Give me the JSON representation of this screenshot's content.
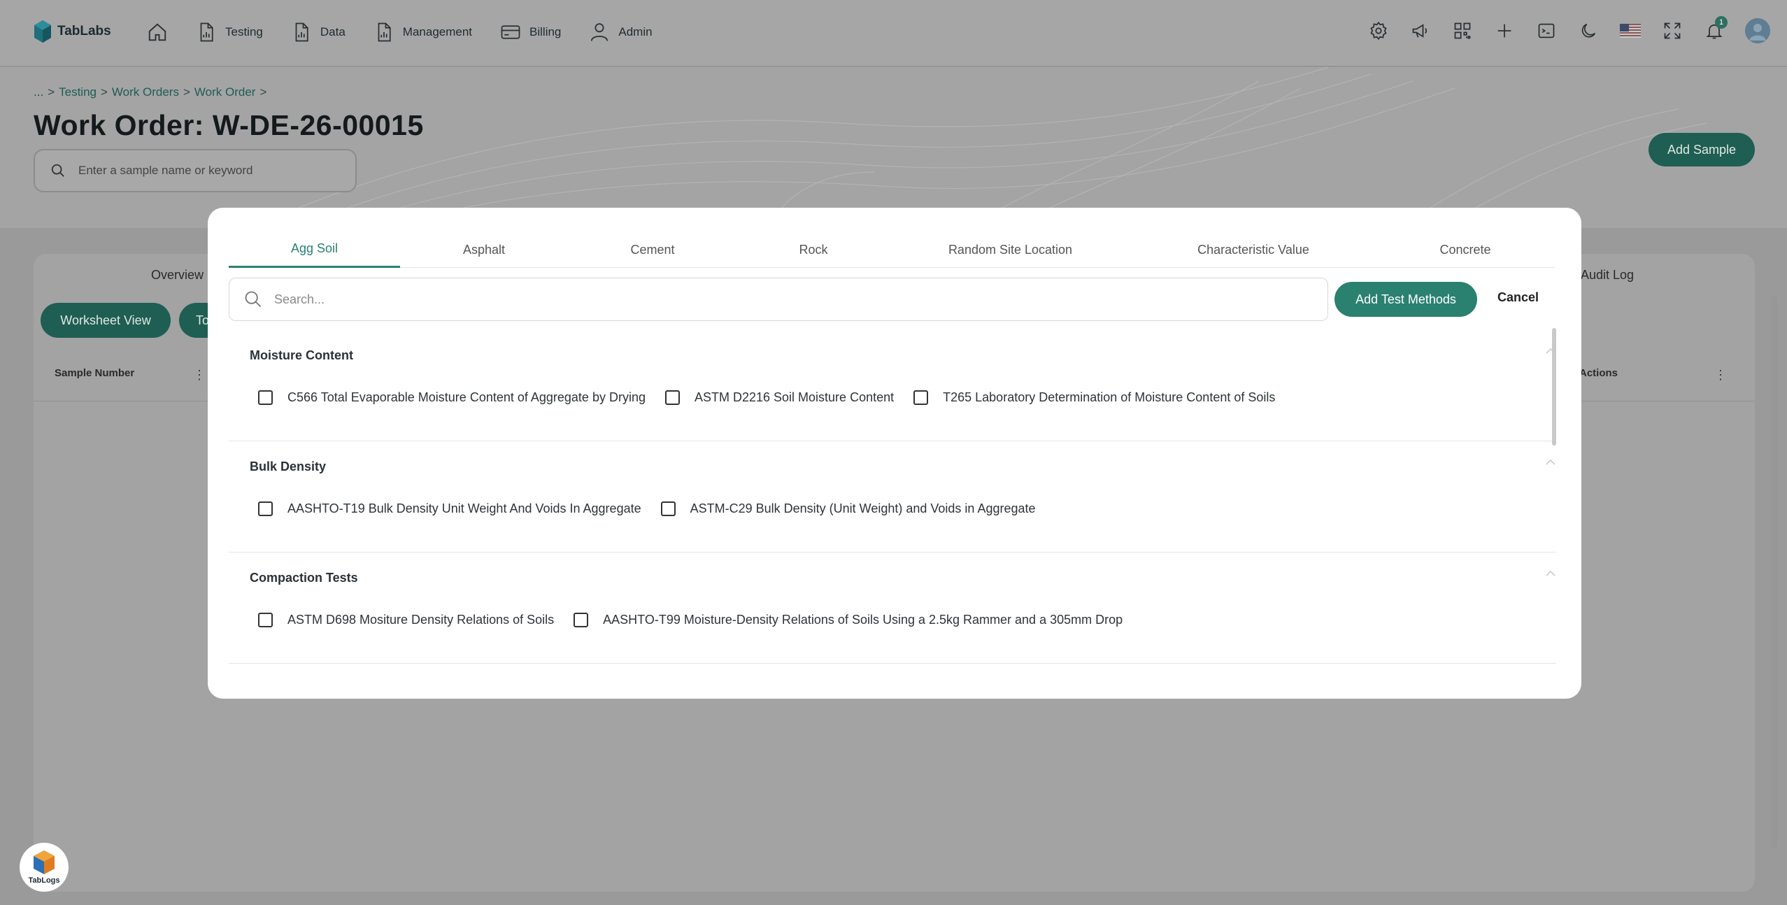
{
  "brand": {
    "name": "TabLabs"
  },
  "nav": [
    {
      "label": "",
      "icon": "home-icon"
    },
    {
      "label": "Testing",
      "icon": "document-chart-icon"
    },
    {
      "label": "Data",
      "icon": "document-chart-icon"
    },
    {
      "label": "Management",
      "icon": "document-chart-icon"
    },
    {
      "label": "Billing",
      "icon": "credit-card-icon"
    },
    {
      "label": "Admin",
      "icon": "user-icon"
    }
  ],
  "topbar": {
    "icons": [
      "gear-icon",
      "megaphone-icon",
      "qr-code-icon",
      "plus-icon",
      "terminal-icon",
      "moon-icon",
      "us-flag-icon",
      "expand-icon",
      "bell-icon",
      "avatar"
    ],
    "notification_count": "1"
  },
  "breadcrumb": {
    "ellipsis": "...",
    "items": [
      "Testing",
      "Work Orders",
      "Work Order"
    ],
    "separator": ">"
  },
  "page": {
    "title": "Work Order: W-DE-26-00015",
    "search_placeholder": "Enter a sample name or keyword",
    "add_sample_label": "Add Sample"
  },
  "card": {
    "tab_left": "Overview",
    "tab_right": "Audit Log",
    "worksheet_view_label": "Worksheet View",
    "table_view_label_partial": "To",
    "columns": {
      "sample_number": "Sample Number",
      "actions": "Actions"
    }
  },
  "modal": {
    "tabs": [
      {
        "label": "Agg Soil",
        "active": true
      },
      {
        "label": "Asphalt",
        "active": false
      },
      {
        "label": "Cement",
        "active": false
      },
      {
        "label": "Rock",
        "active": false
      },
      {
        "label": "Random Site Location",
        "active": false
      },
      {
        "label": "Characteristic Value",
        "active": false
      },
      {
        "label": "Concrete",
        "active": false
      }
    ],
    "search_placeholder": "Search...",
    "add_test_methods_label": "Add Test Methods",
    "cancel_label": "Cancel",
    "groups": [
      {
        "title": "Moisture Content",
        "items": [
          {
            "label": "C566 Total Evaporable Moisture Content of Aggregate by Drying",
            "checked": false
          },
          {
            "label": "ASTM D2216 Soil Moisture Content",
            "checked": false
          },
          {
            "label": "T265 Laboratory Determination of Moisture Content of Soils",
            "checked": false
          }
        ]
      },
      {
        "title": "Bulk Density",
        "items": [
          {
            "label": "AASHTO-T19 Bulk Density Unit Weight And Voids In Aggregate",
            "checked": false
          },
          {
            "label": "ASTM-C29 Bulk Density (Unit Weight) and Voids in Aggregate",
            "checked": false
          }
        ]
      },
      {
        "title": "Compaction Tests",
        "items": [
          {
            "label": "ASTM D698 Mositure Density Relations of Soils",
            "checked": false
          },
          {
            "label": "AASHTO-T99 Moisture-Density Relations of Soils Using a 2.5kg Rammer and a 305mm Drop",
            "checked": false
          }
        ]
      }
    ]
  },
  "widget": {
    "label": "TabLogs"
  },
  "colors": {
    "accent": "#2a8170",
    "accent_dark": "#1f5e52",
    "overlay": "#9a9a9a"
  }
}
